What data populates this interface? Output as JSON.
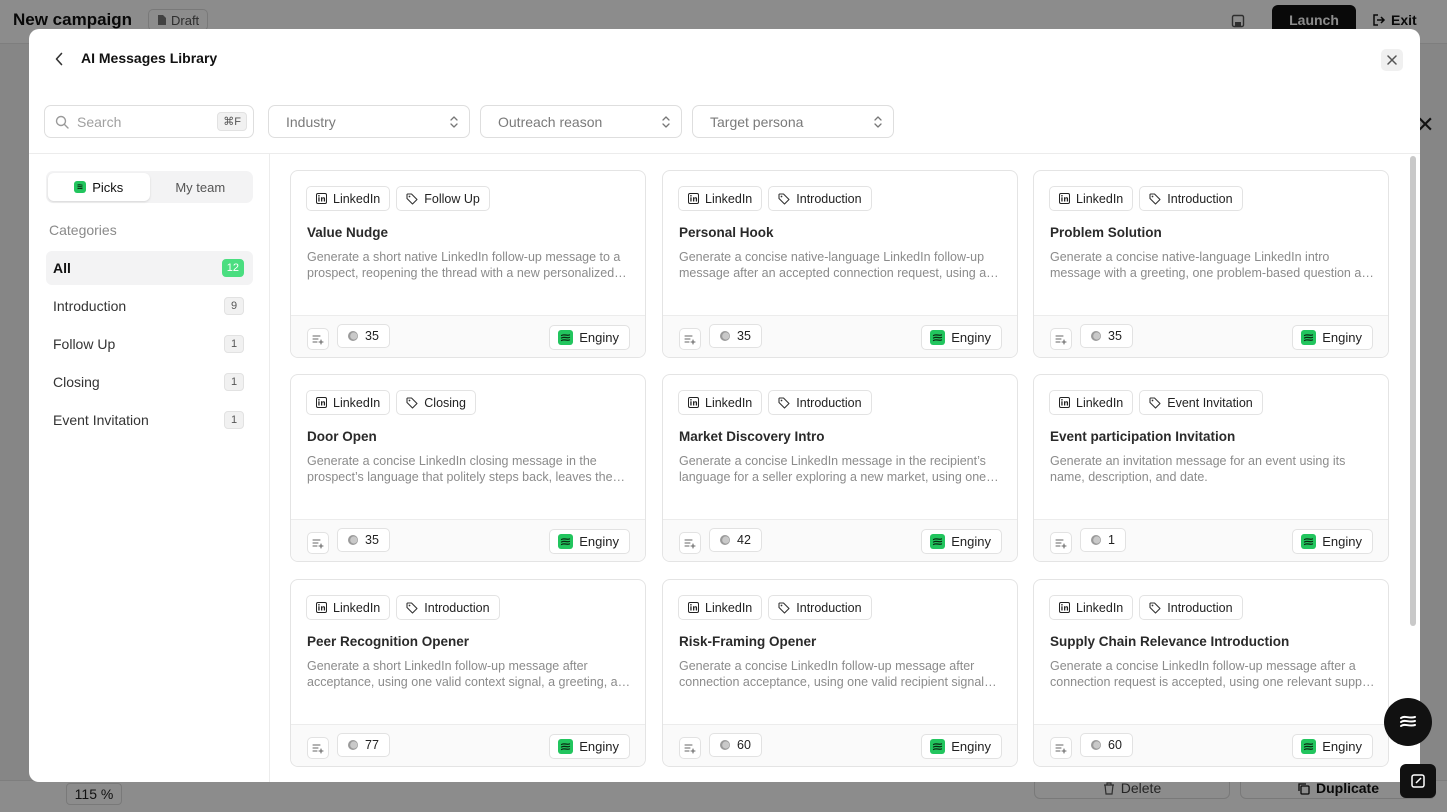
{
  "background": {
    "campaign_title": "New campaign",
    "draft_label": "Draft",
    "launch_label": "Launch",
    "exit_label": "Exit",
    "zoom_level": "115 %",
    "delete_label": "Delete",
    "duplicate_label": "Duplicate"
  },
  "modal": {
    "title": "AI Messages Library",
    "search": {
      "placeholder": "Search",
      "shortcut": "⌘F"
    },
    "filters": {
      "industry": "Industry",
      "outreach_reason": "Outreach reason",
      "target_persona": "Target persona"
    },
    "segment": {
      "picks": "Picks",
      "my_team": "My team"
    },
    "categories_heading": "Categories",
    "categories": [
      {
        "label": "All",
        "count": "12"
      },
      {
        "label": "Introduction",
        "count": "9"
      },
      {
        "label": "Follow Up",
        "count": "1"
      },
      {
        "label": "Closing",
        "count": "1"
      },
      {
        "label": "Event Invitation",
        "count": "1"
      }
    ],
    "cards": [
      {
        "channel": "LinkedIn",
        "tag": "Follow Up",
        "title": "Value Nudge",
        "description": "Generate a short native LinkedIn follow-up message to a prospect, reopening the thread with a new personalized value nudge.",
        "uses": "35",
        "author": "Enginy"
      },
      {
        "channel": "LinkedIn",
        "tag": "Introduction",
        "title": "Personal Hook",
        "description": "Generate a concise native-language LinkedIn follow-up message after an accepted connection request, using a personal hook.",
        "uses": "35",
        "author": "Enginy"
      },
      {
        "channel": "LinkedIn",
        "tag": "Introduction",
        "title": "Problem Solution",
        "description": "Generate a concise native-language LinkedIn intro message with a greeting, one problem-based question and a solution.",
        "uses": "35",
        "author": "Enginy"
      },
      {
        "channel": "LinkedIn",
        "tag": "Closing",
        "title": "Door Open",
        "description": "Generate a concise LinkedIn closing message in the prospect’s language that politely steps back, leaves the door open.",
        "uses": "35",
        "author": "Enginy"
      },
      {
        "channel": "LinkedIn",
        "tag": "Introduction",
        "title": "Market Discovery Intro",
        "description": "Generate a concise LinkedIn message in the recipient’s language for a seller exploring a new market, using one signal.",
        "uses": "42",
        "author": "Enginy"
      },
      {
        "channel": "LinkedIn",
        "tag": "Event Invitation",
        "title": "Event participation Invitation",
        "description": "Generate an invitation message for an event using its name, description, and date.",
        "uses": "1",
        "author": "Enginy"
      },
      {
        "channel": "LinkedIn",
        "tag": "Introduction",
        "title": "Peer Recognition Opener",
        "description": "Generate a short LinkedIn follow-up message after acceptance, using one valid context signal, a greeting, and a peer note.",
        "uses": "77",
        "author": "Enginy"
      },
      {
        "channel": "LinkedIn",
        "tag": "Introduction",
        "title": "Risk-Framing Opener",
        "description": "Generate a concise LinkedIn follow-up message after connection acceptance, using one valid recipient signal and risk framing.",
        "uses": "60",
        "author": "Enginy"
      },
      {
        "channel": "LinkedIn",
        "tag": "Introduction",
        "title": "Supply Chain Relevance Introduction",
        "description": "Generate a concise LinkedIn follow-up message after a connection request is accepted, using one relevant supply chain signal.",
        "uses": "60",
        "author": "Enginy"
      }
    ]
  },
  "colors": {
    "accent_green": "#22c55e",
    "count_active": "#4ade80",
    "dark": "#111111"
  },
  "icons": [
    "chevron-left-icon",
    "close-icon",
    "search-icon",
    "chevron-up-down-icon",
    "linkedin-icon",
    "tag-icon",
    "add-to-sequence-icon",
    "coin-icon",
    "enginy-logo-icon"
  ]
}
